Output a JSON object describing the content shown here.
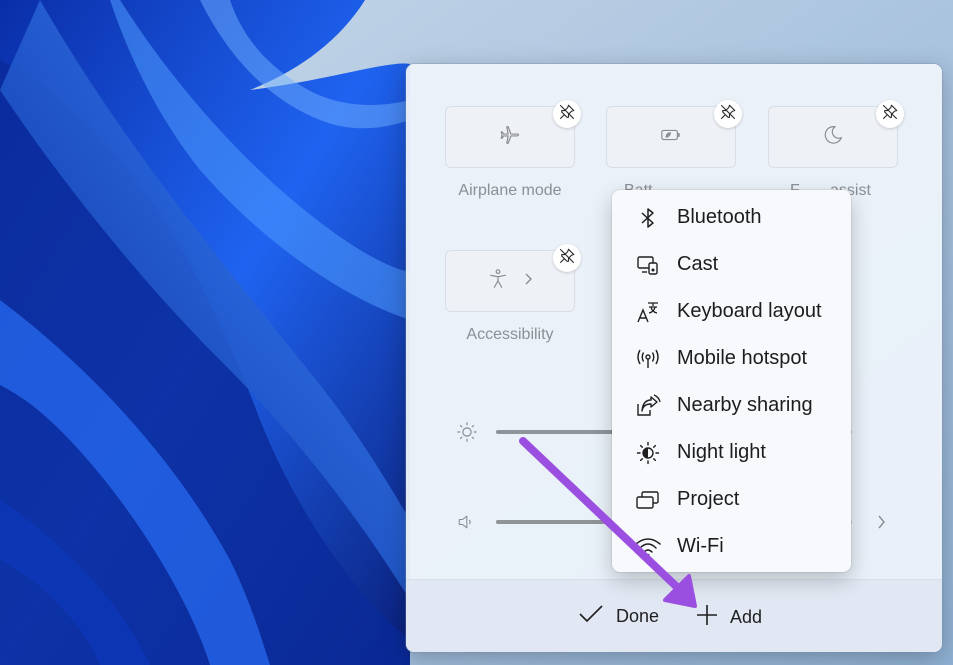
{
  "colors": {
    "accent_purple": "#9b4fe0",
    "wallpaper_blue": "#1a4fd6",
    "panel_bg": "#ecf2fa",
    "menu_bg": "#f7f9fc",
    "muted_text": "#8c8f94"
  },
  "tiles": [
    {
      "label": "Airplane mode",
      "icon": "airplane-icon"
    },
    {
      "label": "Batt",
      "icon": "battery-saver-icon"
    },
    {
      "label": "F",
      "label_right": "assist",
      "icon": "moon-icon"
    },
    {
      "label": "Accessibility",
      "icon": "accessibility-icon"
    }
  ],
  "sliders": {
    "brightness": {
      "icon": "sun-icon",
      "level": 0.45
    },
    "volume": {
      "icon": "speaker-icon",
      "level": 0.4
    }
  },
  "menu": {
    "items": [
      {
        "label": "Bluetooth",
        "icon": "bluetooth-icon"
      },
      {
        "label": "Cast",
        "icon": "cast-icon"
      },
      {
        "label": "Keyboard layout",
        "icon": "keyboard-layout-icon"
      },
      {
        "label": "Mobile hotspot",
        "icon": "mobile-hotspot-icon"
      },
      {
        "label": "Nearby sharing",
        "icon": "nearby-sharing-icon"
      },
      {
        "label": "Night light",
        "icon": "night-light-icon"
      },
      {
        "label": "Project",
        "icon": "project-icon"
      },
      {
        "label": "Wi-Fi",
        "icon": "wifi-icon"
      }
    ]
  },
  "footer": {
    "done_label": "Done",
    "add_label": "Add"
  }
}
